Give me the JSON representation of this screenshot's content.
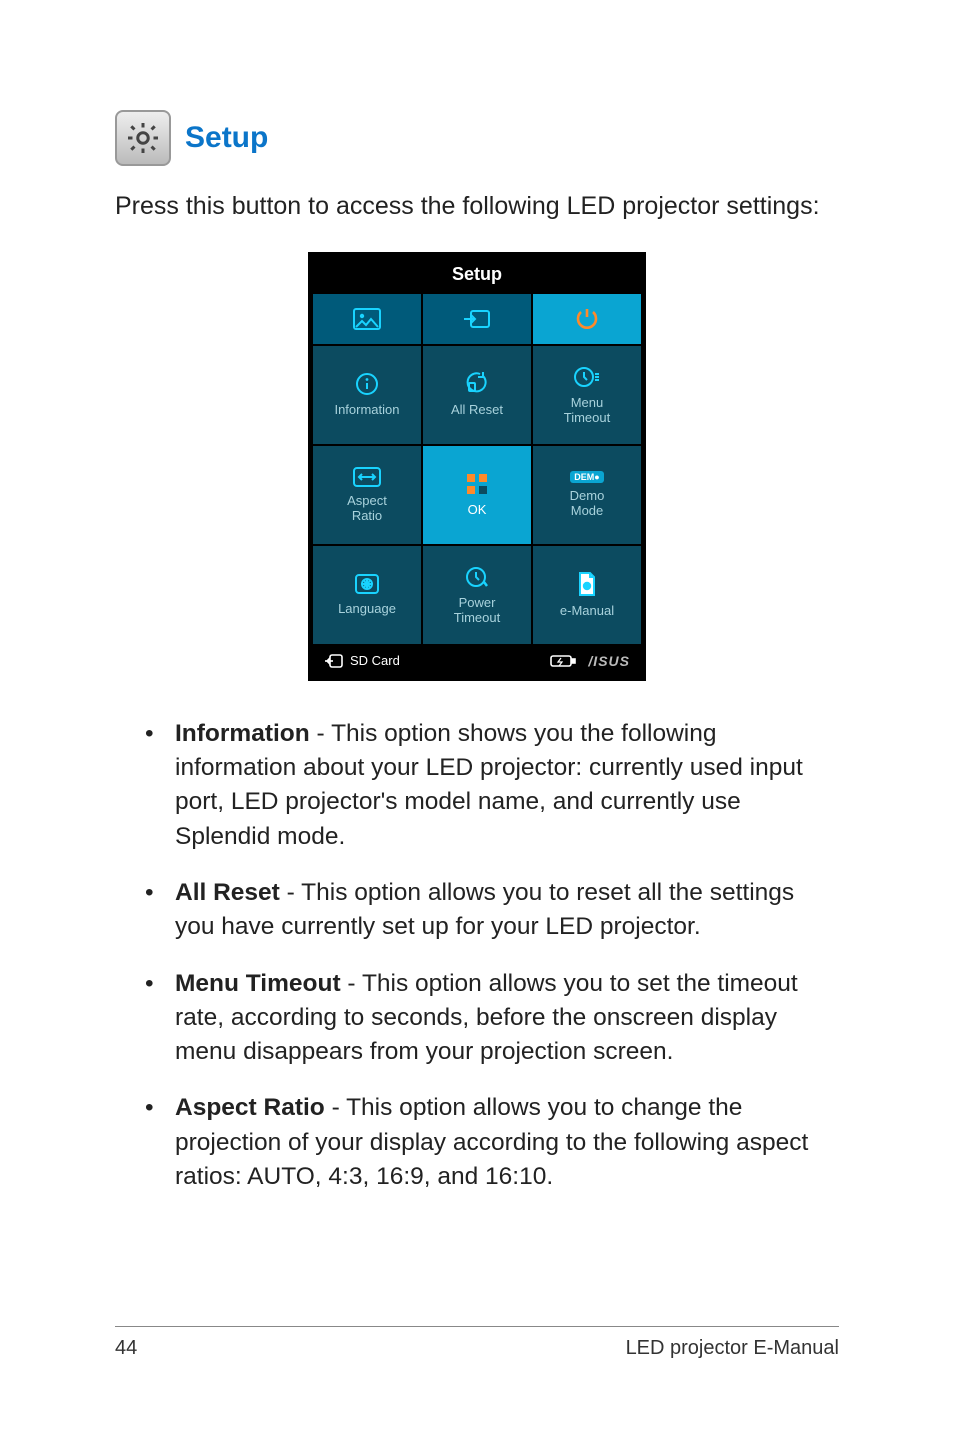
{
  "header": {
    "title": "Setup",
    "intro": "Press this button to access the following LED projector settings:"
  },
  "screenshot": {
    "title": "Setup",
    "nav": [
      {
        "name": "picture-icon",
        "hl": false
      },
      {
        "name": "input-icon",
        "hl": false
      },
      {
        "name": "power-icon",
        "hl": true
      }
    ],
    "tiles": [
      {
        "name": "information",
        "label": "Information",
        "hl": false
      },
      {
        "name": "all-reset",
        "label": "All Reset",
        "hl": false
      },
      {
        "name": "menu-timeout",
        "label": "Menu\nTimeout",
        "hl": false
      },
      {
        "name": "aspect-ratio",
        "label": "Aspect\nRatio",
        "hl": false
      },
      {
        "name": "ok",
        "label": "OK",
        "hl": true
      },
      {
        "name": "demo-mode",
        "label": "Demo\nMode",
        "hl": false
      },
      {
        "name": "language",
        "label": "Language",
        "hl": false
      },
      {
        "name": "power-timeout",
        "label": "Power\nTimeout",
        "hl": false
      },
      {
        "name": "e-manual",
        "label": "e-Manual",
        "hl": false
      }
    ],
    "status": {
      "card": "SD Card",
      "brand": "/ISUS"
    }
  },
  "bullets": [
    {
      "term": "Information",
      "desc": " - This option shows you the following information about your LED projector: currently used input port, LED projector's model name, and currently use Splendid mode."
    },
    {
      "term": "All Reset",
      "desc": " - This option allows you to reset all the settings you have currently set up for your LED projector."
    },
    {
      "term": "Menu Timeout",
      "desc": " - This option allows you to set the timeout rate, according to seconds, before the onscreen display menu disappears from your projection screen."
    },
    {
      "term": "Aspect Ratio",
      "desc": " - This option allows you to change the projection of your display according to the following aspect ratios: AUTO, 4:3, 16:9, and 16:10."
    }
  ],
  "footer": {
    "page": "44",
    "doc": "LED projector E-Manual"
  }
}
